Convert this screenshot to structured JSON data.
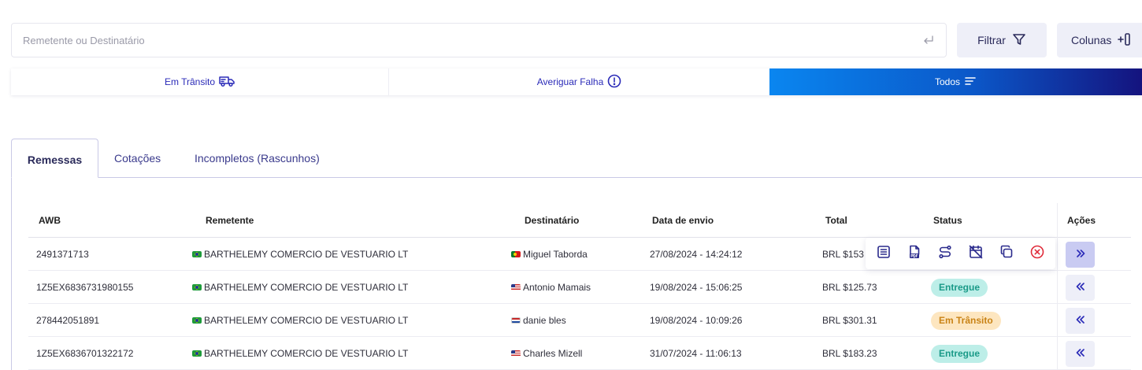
{
  "search": {
    "placeholder": "Remetente ou Destinatário"
  },
  "toolbar": {
    "filter_label": "Filtrar",
    "columns_label": "Colunas"
  },
  "status_filter": [
    {
      "label": "Em Trânsito",
      "icon": "truck-icon",
      "active": false
    },
    {
      "label": "Averiguar Falha",
      "icon": "alert-circle-icon",
      "active": false
    },
    {
      "label": "Todos",
      "icon": "list-icon",
      "active": true
    }
  ],
  "tabs": [
    {
      "label": "Remessas",
      "active": true
    },
    {
      "label": "Cotações",
      "active": false
    },
    {
      "label": "Incompletos (Rascunhos)",
      "active": false
    }
  ],
  "table": {
    "headers": {
      "awb": "AWB",
      "remetente": "Remetente",
      "destinatario": "Destinatário",
      "data": "Data de envio",
      "total": "Total",
      "status": "Status",
      "acoes": "Ações"
    },
    "rows": [
      {
        "awb": "2491371713",
        "remetente": "BARTHELEMY COMERCIO DE VESTUARIO LT",
        "remetente_flag": "br",
        "destinatario": "Miguel Taborda",
        "destinatario_flag": "pt",
        "data": "27/08/2024 - 14:24:12",
        "total": "BRL $153",
        "status": "",
        "status_color": "",
        "action_icon": "chevrons-right-icon"
      },
      {
        "awb": "1Z5EX6836731980155",
        "remetente": "BARTHELEMY COMERCIO DE VESTUARIO LT",
        "remetente_flag": "br",
        "destinatario": "Antonio Mamais",
        "destinatario_flag": "us",
        "data": "19/08/2024 - 15:06:25",
        "total": "BRL $125.73",
        "status": "Entregue",
        "status_color": "green",
        "action_icon": "chevrons-left-icon"
      },
      {
        "awb": "278442051891",
        "remetente": "BARTHELEMY COMERCIO DE VESTUARIO LT",
        "remetente_flag": "br",
        "destinatario": "danie bles",
        "destinatario_flag": "nl",
        "data": "19/08/2024 - 10:09:26",
        "total": "BRL $301.31",
        "status": "Em Trânsito",
        "status_color": "orange",
        "action_icon": "chevrons-left-icon"
      },
      {
        "awb": "1Z5EX6836701322172",
        "remetente": "BARTHELEMY COMERCIO DE VESTUARIO LT",
        "remetente_flag": "br",
        "destinatario": "Charles Mizell",
        "destinatario_flag": "us",
        "data": "31/07/2024 - 11:06:13",
        "total": "BRL $183.23",
        "status": "Entregue",
        "status_color": "green",
        "action_icon": "chevrons-left-icon"
      }
    ]
  },
  "row_actions": [
    {
      "icon": "document-lines-icon"
    },
    {
      "icon": "pdf-icon"
    },
    {
      "icon": "route-icon"
    },
    {
      "icon": "calendar-cancel-icon"
    },
    {
      "icon": "copy-icon"
    },
    {
      "icon": "cancel-circle-icon"
    }
  ],
  "colors": {
    "accent": "#2b2bb8",
    "gradient_start": "#0a86f0",
    "gradient_end": "#14137e",
    "badge_green_bg": "#bdeee8",
    "badge_orange_bg": "#fde6c0",
    "cancel_red": "#e02b3a"
  }
}
